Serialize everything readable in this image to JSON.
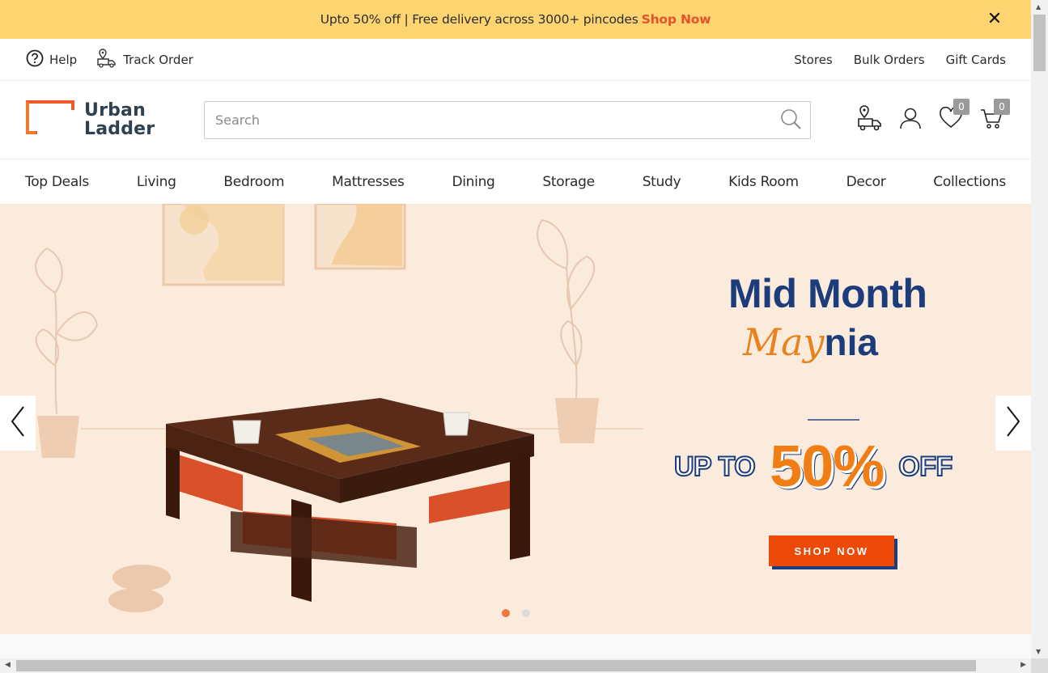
{
  "promo": {
    "text": "Upto 50% off | Free delivery across 3000+ pincodes",
    "link": "Shop Now",
    "close": "✕"
  },
  "util": {
    "help": "Help",
    "track_order": "Track Order",
    "stores": "Stores",
    "bulk_orders": "Bulk Orders",
    "gift_cards": "Gift Cards"
  },
  "header": {
    "logo_line1": "Urban",
    "logo_line2": "Ladder",
    "search_placeholder": "Search",
    "wishlist_count": "0",
    "cart_count": "0"
  },
  "nav": {
    "items": [
      "Top Deals",
      "Living",
      "Bedroom",
      "Mattresses",
      "Dining",
      "Storage",
      "Study",
      "Kids Room",
      "Decor",
      "Collections"
    ]
  },
  "hero": {
    "title_line1": "Mid Month",
    "title_script": "May",
    "title_rest": "nia",
    "upto": "UP TO",
    "percent": "50%",
    "off": "OFF",
    "cta": "SHOP NOW"
  },
  "colors": {
    "promo_bg": "#fed571",
    "accent_orange": "#ed4a0a",
    "brand_navy": "#1d3c7c",
    "hero_bg": "#fbebdc"
  }
}
